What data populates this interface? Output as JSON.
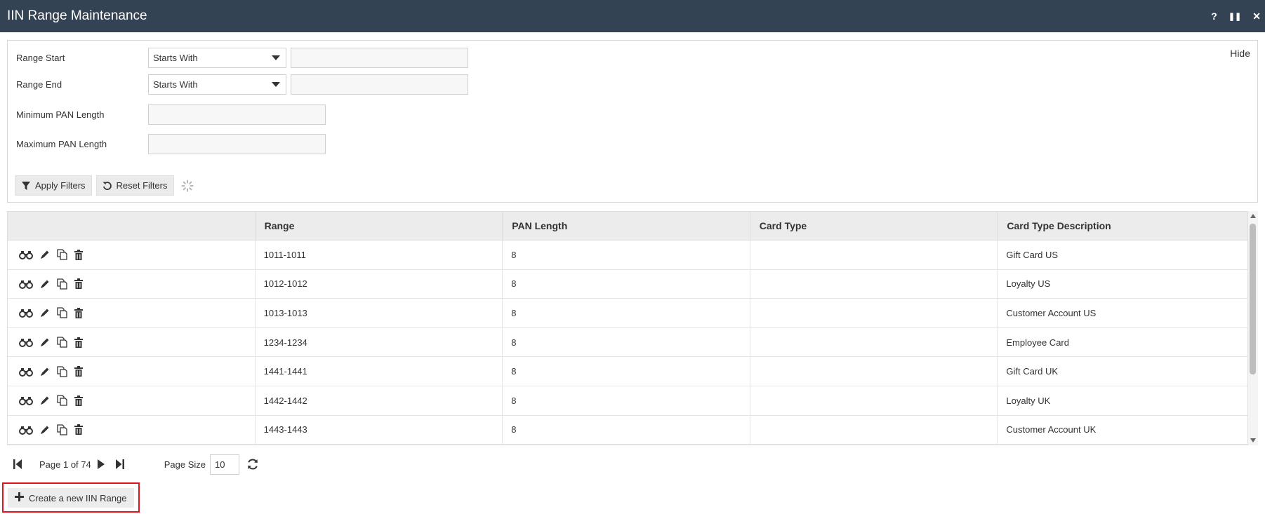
{
  "window": {
    "title": "IIN Range Maintenance",
    "controls": {
      "help": "?",
      "pause": "❚❚",
      "close": "✕"
    }
  },
  "filters": {
    "hide_label": "Hide",
    "range_start": {
      "label": "Range Start",
      "operator": "Starts With",
      "value": ""
    },
    "range_end": {
      "label": "Range End",
      "operator": "Starts With",
      "value": ""
    },
    "min_pan_length": {
      "label": "Minimum PAN Length",
      "value": ""
    },
    "max_pan_length": {
      "label": "Maximum PAN Length",
      "value": ""
    },
    "apply_label": "Apply Filters",
    "reset_label": "Reset Filters"
  },
  "grid": {
    "columns": [
      "",
      "Range",
      "PAN Length",
      "Card Type",
      "Card Type Description"
    ],
    "rows": [
      {
        "range": "1011-1011",
        "pan_length": "8",
        "card_type": "",
        "description": "Gift Card US"
      },
      {
        "range": "1012-1012",
        "pan_length": "8",
        "card_type": "",
        "description": "Loyalty US"
      },
      {
        "range": "1013-1013",
        "pan_length": "8",
        "card_type": "",
        "description": "Customer Account US"
      },
      {
        "range": "1234-1234",
        "pan_length": "8",
        "card_type": "",
        "description": "Employee Card"
      },
      {
        "range": "1441-1441",
        "pan_length": "8",
        "card_type": "",
        "description": "Gift Card UK"
      },
      {
        "range": "1442-1442",
        "pan_length": "8",
        "card_type": "",
        "description": "Loyalty UK"
      },
      {
        "range": "1443-1443",
        "pan_length": "8",
        "card_type": "",
        "description": "Customer Account UK"
      }
    ],
    "row_actions": [
      "view-icon",
      "edit-icon",
      "copy-icon",
      "delete-icon"
    ]
  },
  "pager": {
    "page_text": "Page 1 of 74",
    "page_size_label": "Page Size",
    "page_size": "10"
  },
  "create_button": {
    "label": "Create a new IIN Range"
  },
  "colors": {
    "titlebar": "#344353",
    "highlight": "#e0151b"
  }
}
